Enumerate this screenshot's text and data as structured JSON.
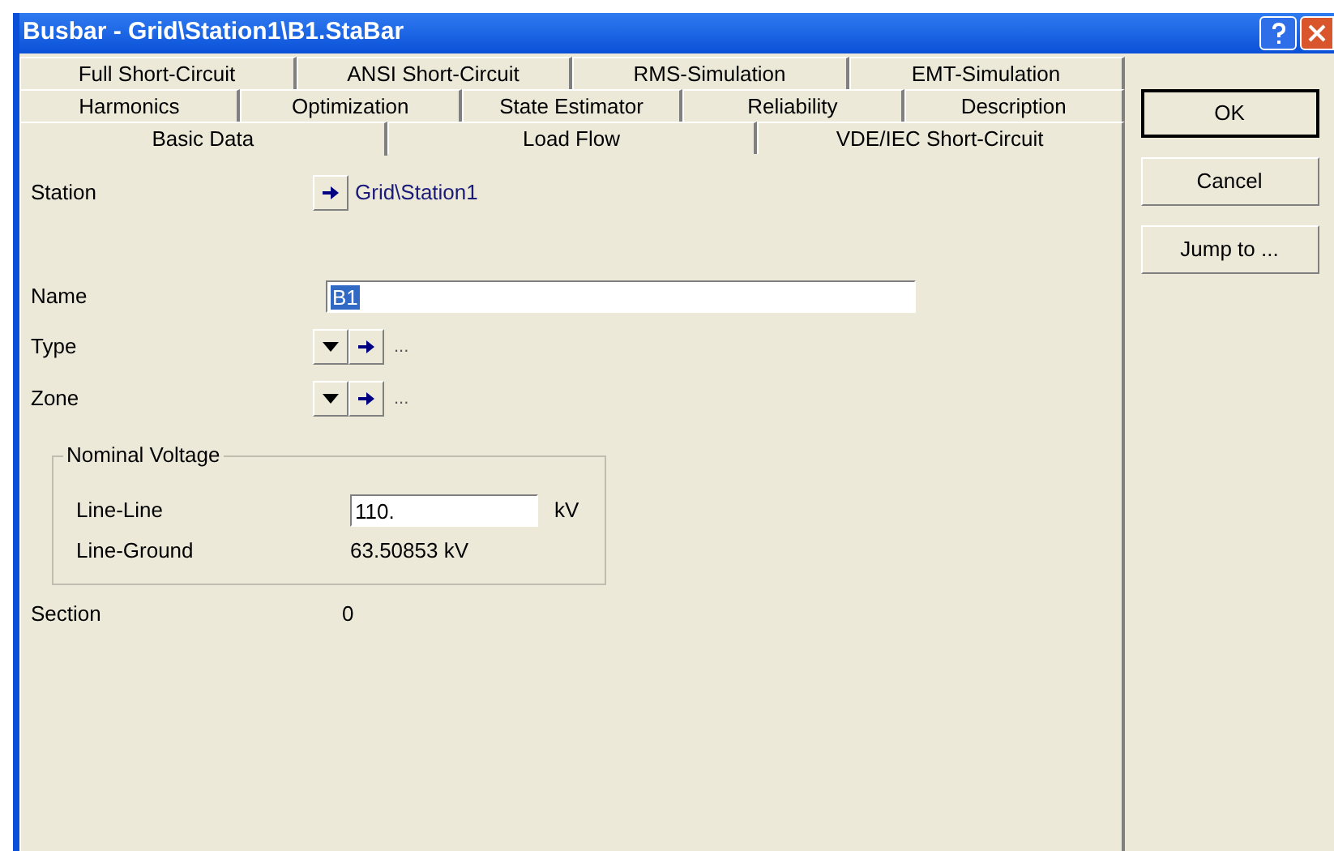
{
  "window": {
    "title": "Busbar - Grid\\Station1\\B1.StaBar"
  },
  "tab_rows": [
    [
      {
        "label": "Full Short-Circuit",
        "selected": false
      },
      {
        "label": "ANSI Short-Circuit",
        "selected": false
      },
      {
        "label": "RMS-Simulation",
        "selected": false
      },
      {
        "label": "EMT-Simulation",
        "selected": false
      }
    ],
    [
      {
        "label": "Harmonics",
        "selected": false
      },
      {
        "label": "Optimization",
        "selected": false
      },
      {
        "label": "State Estimator",
        "selected": false
      },
      {
        "label": "Reliability",
        "selected": false
      },
      {
        "label": "Description",
        "selected": false
      }
    ],
    [
      {
        "label": "Basic Data",
        "selected": true
      },
      {
        "label": "Load Flow",
        "selected": false
      },
      {
        "label": "VDE/IEC Short-Circuit",
        "selected": false
      }
    ]
  ],
  "station": {
    "label": "Station",
    "value": "Grid\\Station1"
  },
  "name": {
    "label": "Name",
    "value": "B1"
  },
  "type": {
    "label": "Type",
    "value": "..."
  },
  "zone": {
    "label": "Zone",
    "value": "..."
  },
  "nominal_voltage": {
    "title": "Nominal Voltage",
    "line_line": {
      "label": "Line-Line",
      "value": "110.",
      "unit": "kV"
    },
    "line_ground": {
      "label": "Line-Ground",
      "value": "63.50853 kV"
    }
  },
  "section": {
    "label": "Section",
    "value": "0"
  },
  "buttons": [
    "OK",
    "Cancel",
    "Jump to ..."
  ]
}
